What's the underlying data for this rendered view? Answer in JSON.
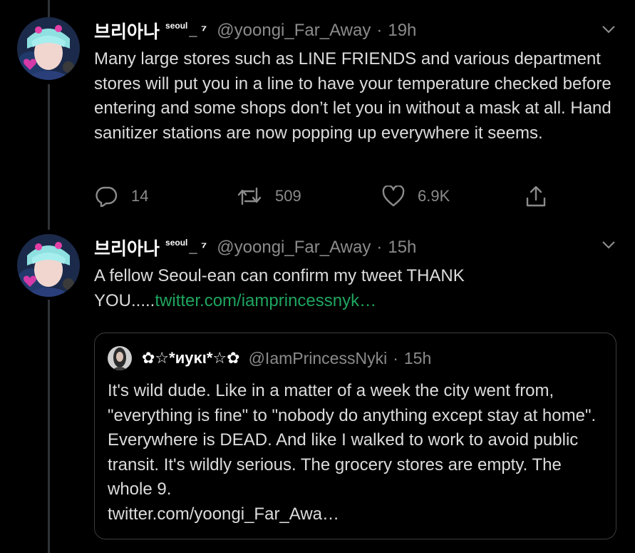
{
  "tweets": [
    {
      "display_name": "브리아나",
      "name_suffix": "seoul",
      "name_tail": "_ ⁷",
      "handle": "@yoongi_Far_Away",
      "dot": "·",
      "time": "19h",
      "text": "Many large stores such as LINE FRIENDS and various department stores will put you in a line to have your temperature checked before entering and some shops don’t let you in without a mask at all. Hand sanitizer stations are now popping up everywhere it seems.",
      "actions": {
        "replies": "14",
        "retweets": "509",
        "likes": "6.9K"
      }
    },
    {
      "display_name": "브리아나",
      "name_suffix": "seoul",
      "name_tail": "_ ⁷",
      "handle": "@yoongi_Far_Away",
      "dot": "·",
      "time": "15h",
      "text": "A fellow Seoul-ean can confirm my tweet THANK YOU.....",
      "link": "twitter.com/iamprincessnyk…",
      "quote": {
        "display_name": "✿☆*иуκι*☆✿",
        "handle": "@IamPrincessNyki",
        "dot": "·",
        "time": "15h",
        "text": "It's wild dude. Like in a matter of a week the city went from, \"everything is fine\" to \"nobody do anything except stay at home\". Everywhere is DEAD. And like I walked to work to avoid public transit. It's wildly serious. The grocery stores are empty. The whole 9.",
        "link": "twitter.com/yoongi_Far_Awa…"
      }
    }
  ],
  "colors": {
    "background": "#000000",
    "text": "#dcdcdc",
    "muted": "#8b8b8b",
    "link": "#1fa55f",
    "border": "#3a3d40"
  },
  "icons": [
    "chevron-down-icon",
    "reply-icon",
    "retweet-icon",
    "like-icon",
    "share-icon"
  ]
}
